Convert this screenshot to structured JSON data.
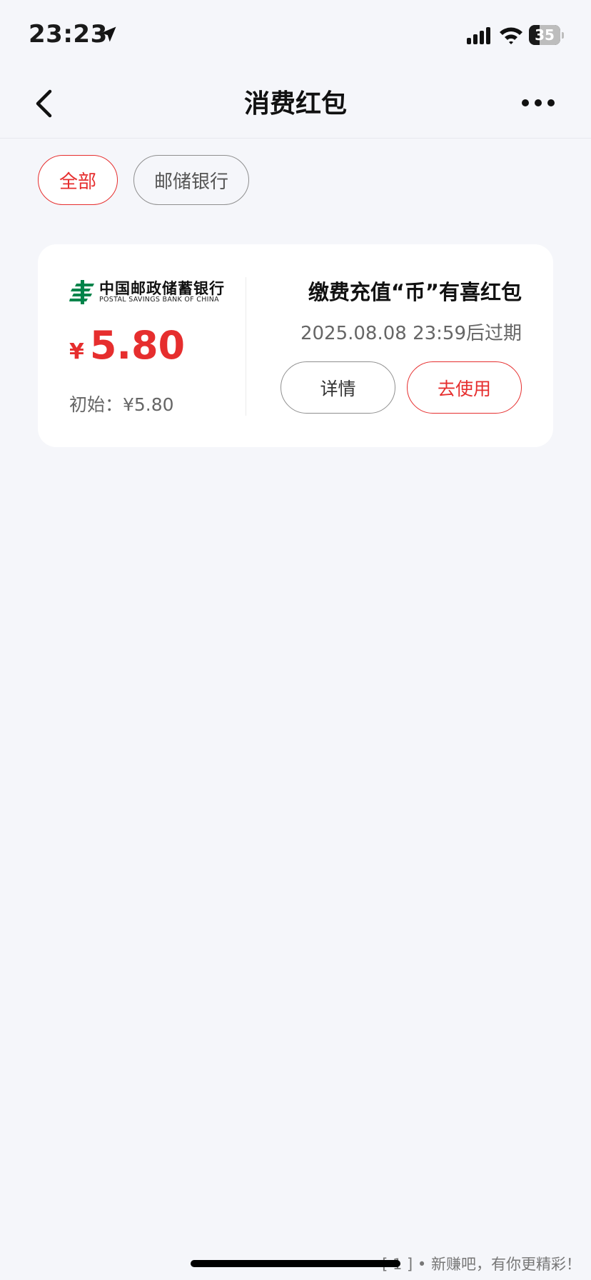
{
  "status_bar": {
    "time": "23:23",
    "battery_level": "35",
    "battery_percent": 35
  },
  "nav": {
    "title": "消费红包",
    "back_icon": "chevron-left-icon",
    "more_icon": "more-horizontal-icon"
  },
  "filters": [
    {
      "label": "全部",
      "selected": true
    },
    {
      "label": "邮储银行",
      "selected": false
    }
  ],
  "coupon": {
    "bank_name_cn": "中国邮政储蓄银行",
    "bank_name_en": "POSTAL SAVINGS BANK OF CHINA",
    "currency_symbol": "¥",
    "amount": "5.80",
    "initial_label": "初始：¥5.80",
    "title": "缴费充值“币”有喜红包",
    "expire_text": "2025.08.08 23:59后过期",
    "detail_button": "详情",
    "use_button": "去使用"
  },
  "watermark": "[ 1 ] • 新赚吧，有你更精彩！",
  "colors": {
    "accent": "#e62e2e",
    "background": "#f5f6fa",
    "card": "#ffffff",
    "logo_green": "#00844a"
  }
}
